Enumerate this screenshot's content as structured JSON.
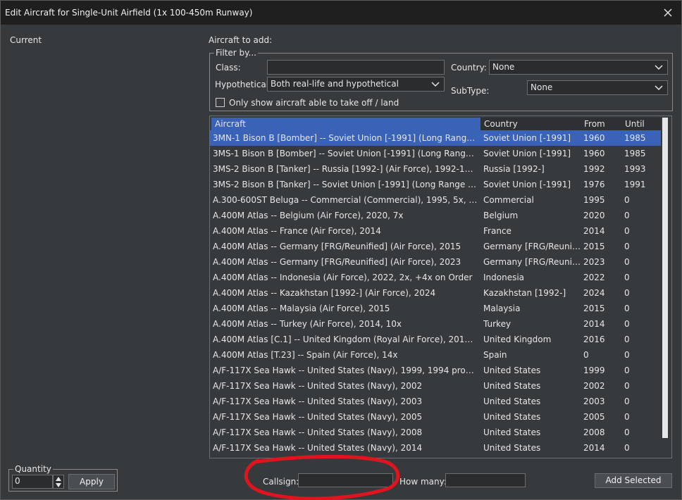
{
  "window": {
    "title": "Edit Aircraft for Single-Unit Airfield (1x 100-450m Runway)"
  },
  "left_panel": {
    "current_label": "Current"
  },
  "add_panel": {
    "title": "Aircraft to add:",
    "filter_legend": "Filter by...",
    "class_label": "Class:",
    "class_value": "",
    "hypothetical_label": "Hypothetical:",
    "hypothetical_value": "Both real-life and hypothetical",
    "country_label": "Country:",
    "country_value": "None",
    "subtype_label": "SubType:",
    "subtype_value": "None",
    "only_show_label": "Only show aircraft able to take off / land",
    "only_show_checked": false
  },
  "table": {
    "columns": [
      "Aircraft",
      "Country",
      "From",
      "Until"
    ],
    "rows": [
      [
        "3MN-1 Bison B [Bomber] -- Soviet Union [-1991] (Long Range Aviation...",
        "Soviet Union [-1991]",
        "1960",
        "1985"
      ],
      [
        "3MS-1 Bison B [Bomber] -- Soviet Union [-1991] (Long Range Aviatio...",
        "Soviet Union [-1991]",
        "1960",
        "1985"
      ],
      [
        "3MS-2 Bison B [Tanker] -- Russia [1992-] (Air Force), 1992-1993",
        "Russia [1992-]",
        "1992",
        "1993"
      ],
      [
        "3MS-2 Bison B [Tanker] -- Soviet Union [-1991] (Long Range Aviation [...",
        "Soviet Union [-1991]",
        "1976",
        "1991"
      ],
      [
        "A.300-600ST Beluga -- Commercial (Commercial), 1995, 5x, Super Gu...",
        "Commercial",
        "1995",
        "0"
      ],
      [
        "A.400M Atlas -- Belgium (Air Force), 2020, 7x",
        "Belgium",
        "2020",
        "0"
      ],
      [
        "A.400M Atlas -- France (Air Force), 2014",
        "France",
        "2014",
        "0"
      ],
      [
        "A.400M Atlas -- Germany [FRG/Reunified] (Air Force), 2015",
        "Germany [FRG/Reunified]",
        "2015",
        "0"
      ],
      [
        "A.400M Atlas -- Germany [FRG/Reunified] (Air Force), 2023",
        "Germany [FRG/Reunified]",
        "2023",
        "0"
      ],
      [
        "A.400M Atlas -- Indonesia (Air Force), 2022, 2x, +4x on Order",
        "Indonesia",
        "2022",
        "0"
      ],
      [
        "A.400M Atlas -- Kazakhstan [1992-] (Air Force), 2024",
        "Kazakhstan [1992-]",
        "2024",
        "0"
      ],
      [
        "A.400M Atlas -- Malaysia (Air Force), 2015",
        "Malaysia",
        "2015",
        "0"
      ],
      [
        "A.400M Atlas -- Turkey (Air Force), 2014, 10x",
        "Turkey",
        "2014",
        "0"
      ],
      [
        "A.400M Atlas [C.1] -- United Kingdom (Royal Air Force), 2016, 22x",
        "United Kingdom",
        "2016",
        "0"
      ],
      [
        "A.400M Atlas [T.23] -- Spain (Air Force), 14x",
        "Spain",
        "0",
        "0"
      ],
      [
        "A/F-117X Sea Hawk -- United States (Navy), 1999, 1994 proposed A/F-...",
        "United States",
        "1999",
        "0"
      ],
      [
        "A/F-117X Sea Hawk -- United States (Navy), 2002",
        "United States",
        "2002",
        "0"
      ],
      [
        "A/F-117X Sea Hawk -- United States (Navy), 2003",
        "United States",
        "2003",
        "0"
      ],
      [
        "A/F-117X Sea Hawk -- United States (Navy), 2005",
        "United States",
        "2005",
        "0"
      ],
      [
        "A/F-117X Sea Hawk -- United States (Navy), 2008",
        "United States",
        "2008",
        "0"
      ],
      [
        "A/F-117X Sea Hawk -- United States (Navy), 2014",
        "United States",
        "2014",
        "0"
      ]
    ],
    "selected_row": 0
  },
  "quantity": {
    "legend": "Quantity",
    "value": "0",
    "apply_label": "Apply"
  },
  "bottom": {
    "callsign_label": "Callsign:",
    "callsign_value": "",
    "how_many_label": "How many:",
    "how_many_value": "",
    "add_selected_label": "Add Selected"
  },
  "colors": {
    "selection": "#3a63b8",
    "header": "#3a63b8",
    "annotation": "#e0141e"
  },
  "icons": {
    "close": "close-icon",
    "dropdown": "chevron-down-icon",
    "spin_up": "spin-up-icon",
    "spin_down": "spin-down-icon"
  }
}
